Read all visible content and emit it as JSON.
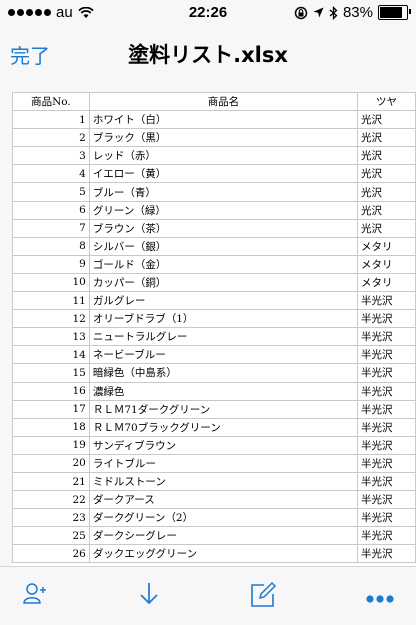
{
  "status": {
    "carrier": "au",
    "time": "22:26",
    "battery": "83%",
    "battery_level": 0.83
  },
  "nav": {
    "done_label": "完了",
    "title": "塗料リスト.xlsx"
  },
  "table": {
    "headers": [
      "商品No.",
      "商品名",
      "ツヤ"
    ],
    "rows": [
      {
        "no": "1",
        "name": "ホワイト（白）",
        "gloss": "光沢"
      },
      {
        "no": "2",
        "name": "ブラック（黒）",
        "gloss": "光沢"
      },
      {
        "no": "3",
        "name": "レッド（赤）",
        "gloss": "光沢"
      },
      {
        "no": "4",
        "name": "イエロー（黄）",
        "gloss": "光沢"
      },
      {
        "no": "5",
        "name": "ブルー（青）",
        "gloss": "光沢"
      },
      {
        "no": "6",
        "name": "グリーン（緑）",
        "gloss": "光沢"
      },
      {
        "no": "7",
        "name": "ブラウン（茶）",
        "gloss": "光沢"
      },
      {
        "no": "8",
        "name": "シルバー（銀）",
        "gloss": "メタリ"
      },
      {
        "no": "9",
        "name": "ゴールド（金）",
        "gloss": "メタリ"
      },
      {
        "no": "10",
        "name": "カッパー（銅）",
        "gloss": "メタリ"
      },
      {
        "no": "11",
        "name": "ガルグレー",
        "gloss": "半光沢"
      },
      {
        "no": "12",
        "name": "オリーブドラブ（1）",
        "gloss": "半光沢"
      },
      {
        "no": "13",
        "name": "ニュートラルグレー",
        "gloss": "半光沢"
      },
      {
        "no": "14",
        "name": "ネービーブルー",
        "gloss": "半光沢"
      },
      {
        "no": "15",
        "name": "暗緑色（中島系）",
        "gloss": "半光沢"
      },
      {
        "no": "16",
        "name": "濃緑色",
        "gloss": "半光沢"
      },
      {
        "no": "17",
        "name": "ＲＬＭ71ダークグリーン",
        "gloss": "半光沢"
      },
      {
        "no": "18",
        "name": "ＲＬＭ70ブラックグリーン",
        "gloss": "半光沢"
      },
      {
        "no": "19",
        "name": "サンディブラウン",
        "gloss": "半光沢"
      },
      {
        "no": "20",
        "name": "ライトブルー",
        "gloss": "半光沢"
      },
      {
        "no": "21",
        "name": "ミドルストーン",
        "gloss": "半光沢"
      },
      {
        "no": "22",
        "name": "ダークアース",
        "gloss": "半光沢"
      },
      {
        "no": "23",
        "name": "ダークグリーン（2）",
        "gloss": "半光沢"
      },
      {
        "no": "25",
        "name": "ダークシーグレー",
        "gloss": "半光沢"
      },
      {
        "no": "26",
        "name": "ダックエッググリーン",
        "gloss": "半光沢"
      }
    ]
  },
  "toolbar": {
    "icons": [
      "add-person-icon",
      "download-icon",
      "edit-icon",
      "more-icon"
    ]
  },
  "colors": {
    "accent": "#1a7ad4"
  }
}
